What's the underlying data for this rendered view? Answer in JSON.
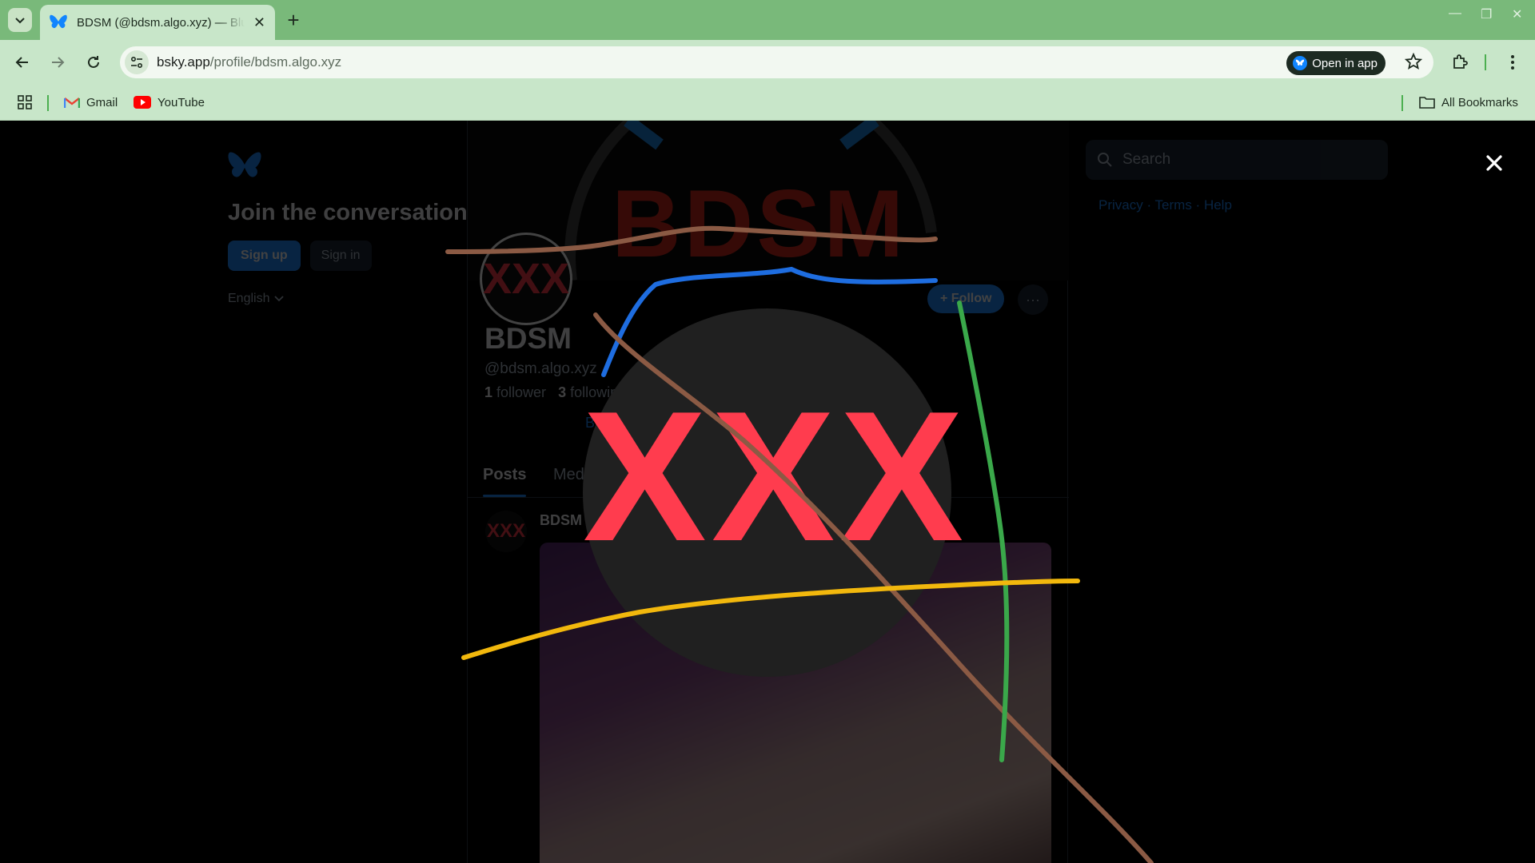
{
  "browser": {
    "tab_title": "BDSM (@bdsm.algo.xyz) — Bluesky",
    "url_host": "bsky.app",
    "url_path": "/profile/bdsm.algo.xyz",
    "open_in_app": "Open in app",
    "bookmarks": [
      {
        "label": "Gmail",
        "icon": "gmail-icon"
      },
      {
        "label": "YouTube",
        "icon": "youtube-icon"
      }
    ],
    "all_bookmarks": "All Bookmarks"
  },
  "sidebar": {
    "heading": "Join the conversation",
    "signup": "Sign up",
    "signin": "Sign in",
    "language": "English"
  },
  "profile": {
    "banner_text": "BDSM",
    "avatar_text": "XXX",
    "follow": "Follow",
    "name": "BDSM",
    "handle": "@bdsm.algo.xyz",
    "followers_count": "1",
    "followers_label": "follower",
    "following_count": "3",
    "following_label": "following",
    "link_fragment": "B",
    "tabs": [
      "Posts",
      "Media"
    ],
    "post_author": "BDSM"
  },
  "right_column": {
    "search_placeholder": "Search",
    "links": [
      "Privacy",
      "Terms",
      "Help"
    ]
  },
  "overlay": {
    "censor_text": "XXX",
    "scribble_colors": [
      "#8b5a44",
      "#1e6de0",
      "#3aa84a",
      "#f2b80d"
    ]
  },
  "colors": {
    "chrome_green": "#79b97a",
    "toolbar_green": "#c8e6c9",
    "bluesky_blue": "#208bfe",
    "censor_red": "#ff3c4e"
  }
}
